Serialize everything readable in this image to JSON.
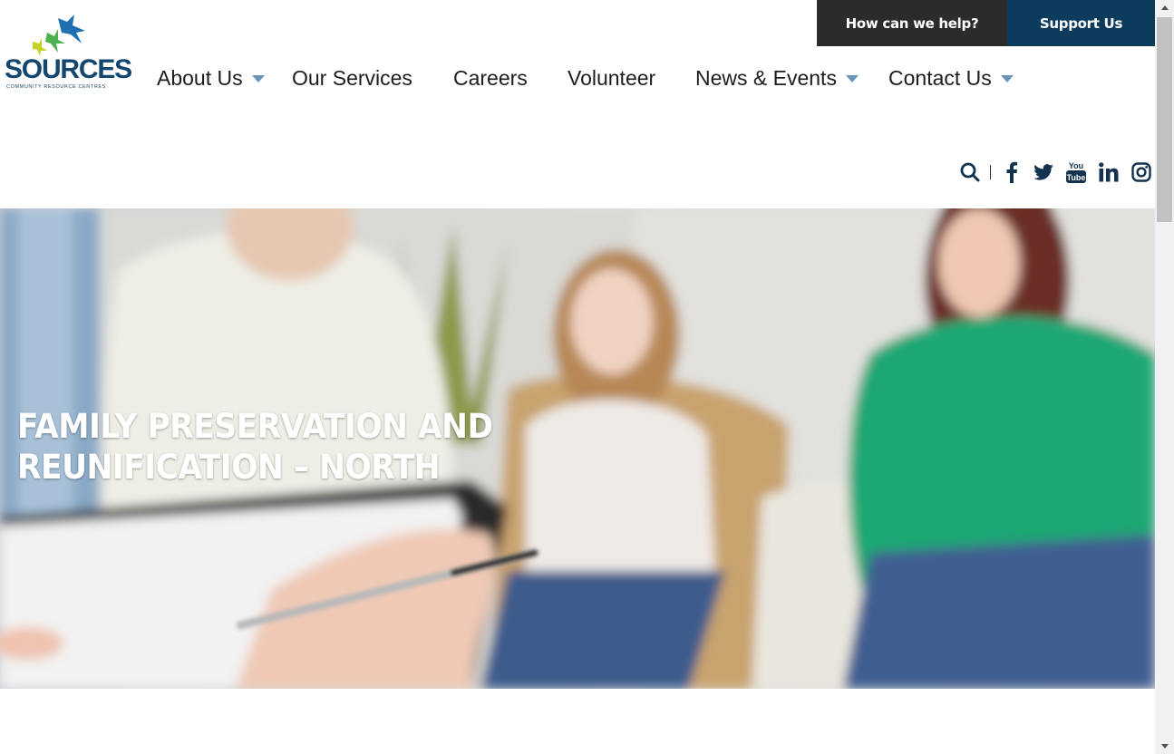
{
  "utility": {
    "help_label": "How can we help?",
    "support_label": "Support Us"
  },
  "logo": {
    "name": "SOURCES",
    "tagline": "COMMUNITY RESOURCE CENTRES"
  },
  "nav": [
    {
      "label": "About Us",
      "has_dropdown": true
    },
    {
      "label": "Our Services",
      "has_dropdown": false
    },
    {
      "label": "Careers",
      "has_dropdown": false
    },
    {
      "label": "Volunteer",
      "has_dropdown": false
    },
    {
      "label": "News & Events",
      "has_dropdown": true
    },
    {
      "label": "Contact Us",
      "has_dropdown": true
    }
  ],
  "social": {
    "icons": [
      "search-icon",
      "facebook-icon",
      "twitter-icon",
      "youtube-icon",
      "linkedin-icon",
      "instagram-icon"
    ],
    "youtube_text_top": "You",
    "youtube_text_bottom": "Tube"
  },
  "hero": {
    "title_line1": "FAMILY PRESERVATION AND",
    "title_line2": "REUNIFICATION – NORTH"
  },
  "colors": {
    "help_bg": "#2b2b2b",
    "support_bg": "#0d3b5e",
    "brand_navy": "#14476f",
    "caret": "#6a93b6",
    "icon": "#13324f"
  }
}
